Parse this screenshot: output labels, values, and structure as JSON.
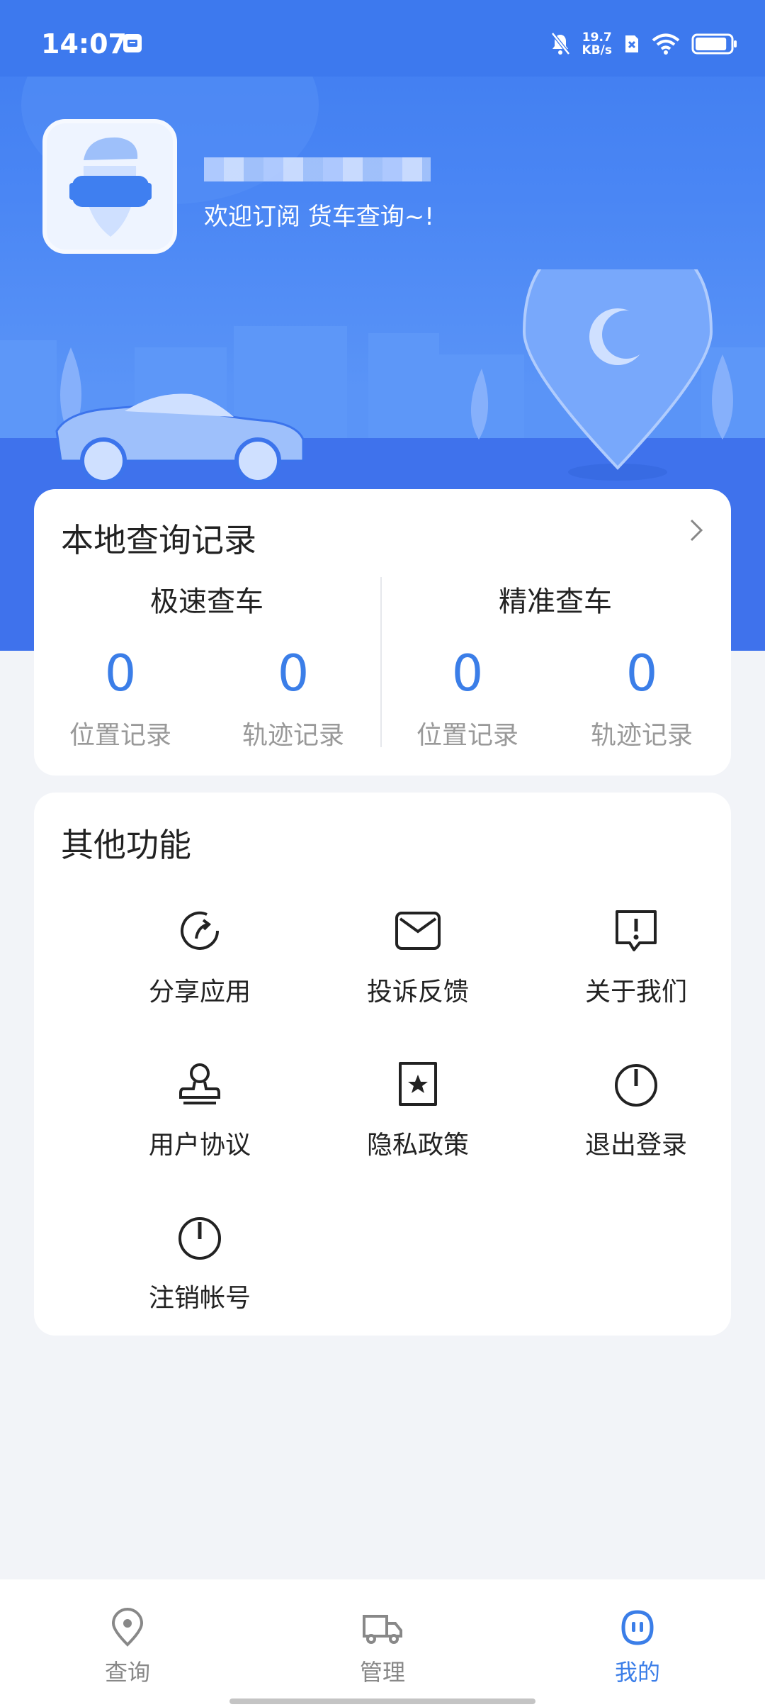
{
  "status_bar": {
    "time": "14:07",
    "net_speed_value": "19.7",
    "net_speed_unit": "KB/s",
    "battery_level": 0.9
  },
  "profile": {
    "welcome": "欢迎订阅 货车查询~!"
  },
  "local_records": {
    "title": "本地查询记录",
    "groups": [
      {
        "title": "极速查车",
        "stats": [
          {
            "value": "0",
            "label": "位置记录"
          },
          {
            "value": "0",
            "label": "轨迹记录"
          }
        ]
      },
      {
        "title": "精准查车",
        "stats": [
          {
            "value": "0",
            "label": "位置记录"
          },
          {
            "value": "0",
            "label": "轨迹记录"
          }
        ]
      }
    ]
  },
  "other_functions": {
    "title": "其他功能",
    "items": [
      {
        "label": "分享应用",
        "icon": "share-icon"
      },
      {
        "label": "投诉反馈",
        "icon": "mail-icon"
      },
      {
        "label": "关于我们",
        "icon": "info-alert-icon"
      },
      {
        "label": "用户协议",
        "icon": "stamp-icon"
      },
      {
        "label": "隐私政策",
        "icon": "star-doc-icon"
      },
      {
        "label": "退出登录",
        "icon": "power-icon"
      },
      {
        "label": "注销帐号",
        "icon": "power-icon"
      }
    ]
  },
  "tabbar": {
    "tabs": [
      {
        "label": "查询",
        "icon": "location-pin-icon",
        "active": false
      },
      {
        "label": "管理",
        "icon": "truck-icon",
        "active": false
      },
      {
        "label": "我的",
        "icon": "profile-face-icon",
        "active": true
      }
    ]
  },
  "colors": {
    "primary": "#3b7ee8",
    "header": "#3d79ee"
  }
}
